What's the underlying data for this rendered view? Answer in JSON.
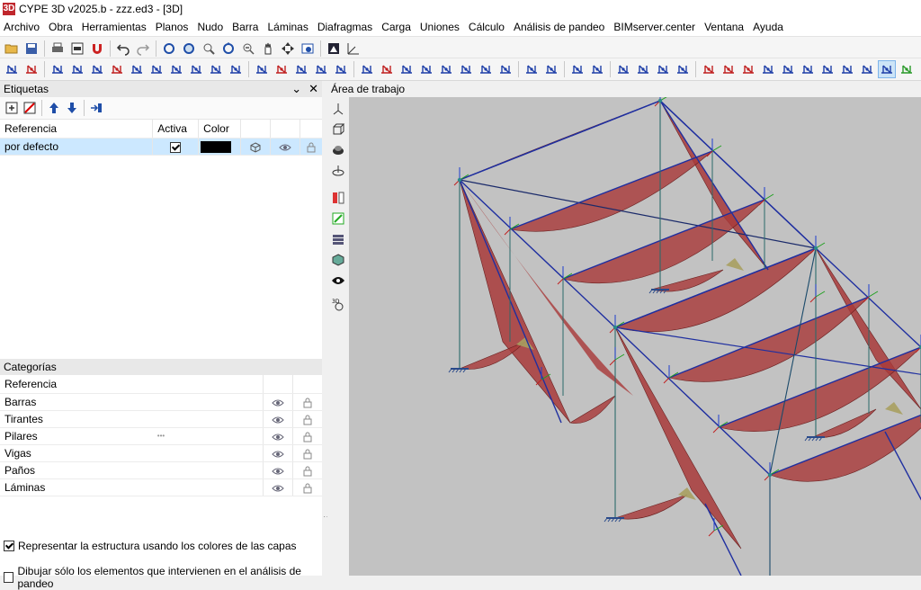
{
  "window": {
    "title": "CYPE 3D v2025.b - zzz.ed3 - [3D]",
    "app_icon_text": "3D"
  },
  "menu": [
    "Archivo",
    "Obra",
    "Herramientas",
    "Planos",
    "Nudo",
    "Barra",
    "Láminas",
    "Diafragmas",
    "Carga",
    "Uniones",
    "Cálculo",
    "Análisis de pandeo",
    "BIMserver.center",
    "Ventana",
    "Ayuda"
  ],
  "etiquetas": {
    "title": "Etiquetas",
    "columns": {
      "ref": "Referencia",
      "activa": "Activa",
      "color": "Color"
    },
    "rows": [
      {
        "referencia": "por defecto",
        "activa": true,
        "color": "#000000"
      }
    ]
  },
  "categorias": {
    "title": "Categorías",
    "header": "Referencia",
    "items": [
      "Barras",
      "Tirantes",
      "Pilares",
      "Vigas",
      "Paños",
      "Láminas"
    ]
  },
  "options": {
    "use_layer_colors": {
      "label": "Representar la estructura usando los colores de las capas",
      "checked": true
    },
    "only_buckling": {
      "label": "Dibujar sólo los elementos que intervienen en el análisis de pandeo",
      "checked": false
    }
  },
  "workarea": {
    "title": "Área de trabajo"
  },
  "colors": {
    "accent": "#0078d7",
    "diagram": "#a83a3a",
    "members": "#1f2fa0",
    "viewport_bg": "#c2c2c2",
    "selection": "#cce8ff"
  }
}
